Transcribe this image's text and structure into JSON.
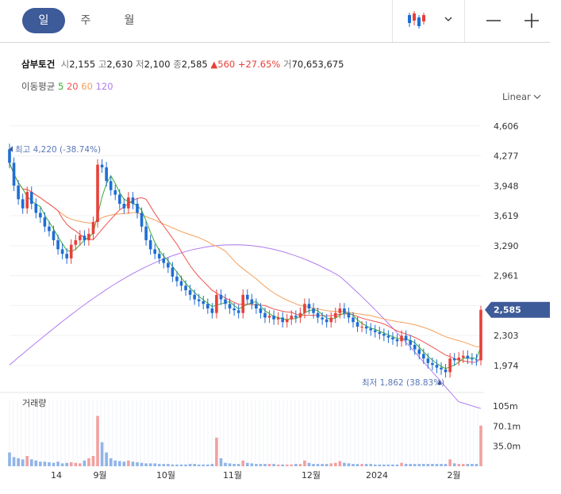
{
  "toolbar": {
    "periods": [
      "일",
      "주",
      "월"
    ],
    "active_period": "일",
    "chart_type_icon": "candlestick-icon",
    "minus_icon": "zoom-out-icon",
    "plus_icon": "zoom-in-icon"
  },
  "stock": {
    "name": "삼부토건",
    "open_label": "시",
    "open": "2,155",
    "high_label": "고",
    "high": "2,630",
    "low_label": "저",
    "low": "2,100",
    "close_label": "종",
    "close": "2,585",
    "change": "560",
    "change_pct": "+27.65%",
    "volume_label": "거",
    "volume": "70,653,675"
  },
  "ma_legend": {
    "label": "이동평균",
    "periods": [
      {
        "label": "5",
        "color": "#3aaa35"
      },
      {
        "label": "20",
        "color": "#ef5350"
      },
      {
        "label": "60",
        "color": "#f5a05a"
      },
      {
        "label": "120",
        "color": "#b07cf0"
      }
    ]
  },
  "scale_mode": "Linear",
  "colors": {
    "up": "#e8403a",
    "down": "#1f6ed4",
    "accent": "#3d5a99"
  },
  "chart_data": {
    "type": "candlestick",
    "price_ticks": [
      "4,606",
      "4,277",
      "3,948",
      "3,619",
      "3,290",
      "2,961",
      "2,632",
      "2,303",
      "1,974"
    ],
    "price_ticks_values": [
      4606,
      4277,
      3948,
      3619,
      3290,
      2961,
      2632,
      2303,
      1974
    ],
    "current_price_label": "2,585",
    "current_price": 2585,
    "max_annotation": "최고 4,220 (-38.74%)",
    "max_price": 4220,
    "min_annotation": "최저 1,862 (38.83%)",
    "min_price": 1862,
    "x_labels": [
      "14",
      "9월",
      "10월",
      "11월",
      "12월",
      "2024",
      "2월"
    ],
    "volume_title": "거래량",
    "volume_ticks": [
      "105m",
      "70.1m",
      "35.0m"
    ],
    "volume_ticks_values": [
      105,
      70.1,
      35.0
    ],
    "closes": [
      4200,
      3950,
      3800,
      3700,
      3880,
      3750,
      3650,
      3600,
      3500,
      3450,
      3350,
      3250,
      3200,
      3150,
      3300,
      3350,
      3400,
      3350,
      3420,
      3550,
      4180,
      4150,
      4000,
      3900,
      3850,
      3750,
      3700,
      3820,
      3750,
      3650,
      3500,
      3350,
      3250,
      3200,
      3150,
      3100,
      3050,
      2950,
      2900,
      2850,
      2800,
      2750,
      2700,
      2680,
      2650,
      2600,
      2550,
      2750,
      2700,
      2650,
      2600,
      2580,
      2550,
      2750,
      2700,
      2650,
      2600,
      2550,
      2500,
      2520,
      2480,
      2500,
      2450,
      2480,
      2520,
      2500,
      2550,
      2650,
      2600,
      2550,
      2500,
      2480,
      2450,
      2500,
      2550,
      2600,
      2550,
      2500,
      2450,
      2400,
      2400,
      2380,
      2360,
      2340,
      2320,
      2300,
      2280,
      2260,
      2240,
      2300,
      2250,
      2200,
      2150,
      2100,
      2050,
      2000,
      1980,
      1950,
      1930,
      1900,
      2050,
      2030,
      2060,
      2080,
      2050,
      2040,
      2030,
      2585
    ],
    "volume_values": [
      24,
      16,
      14,
      12,
      18,
      12,
      10,
      8,
      8,
      7,
      6,
      8,
      5,
      6,
      7,
      6,
      5,
      10,
      14,
      18,
      88,
      42,
      24,
      14,
      10,
      9,
      8,
      10,
      8,
      7,
      6,
      5,
      5,
      5,
      4,
      4,
      4,
      3,
      3,
      3,
      3,
      4,
      4,
      3,
      3,
      3,
      4,
      50,
      14,
      6,
      5,
      4,
      4,
      10,
      6,
      5,
      4,
      4,
      4,
      4,
      4,
      3,
      3,
      3,
      3,
      4,
      4,
      10,
      6,
      4,
      4,
      4,
      4,
      5,
      6,
      9,
      6,
      5,
      4,
      4,
      4,
      4,
      4,
      3,
      3,
      3,
      3,
      3,
      3,
      6,
      4,
      4,
      4,
      4,
      4,
      4,
      4,
      4,
      4,
      4,
      12,
      5,
      4,
      4,
      4,
      4,
      4,
      71
    ]
  }
}
